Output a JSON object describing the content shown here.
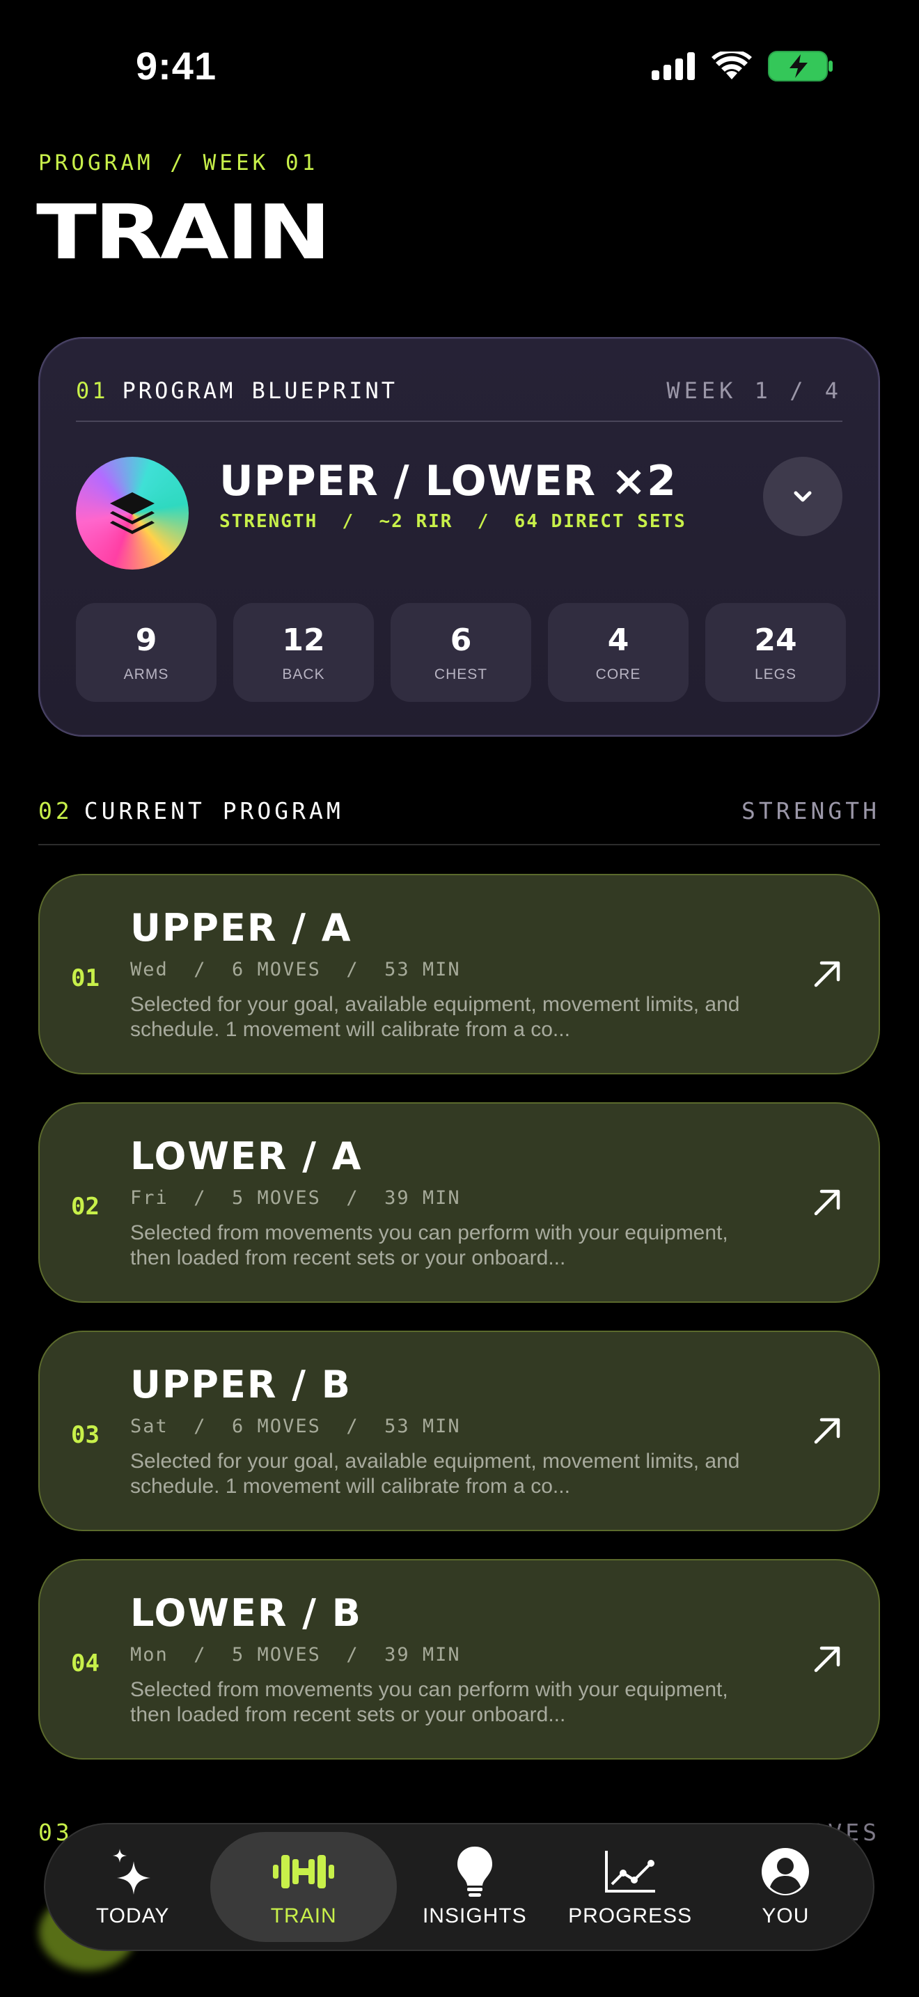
{
  "status_bar": {
    "time": "9:41"
  },
  "header": {
    "breadcrumb": "PROGRAM / WEEK 01",
    "title": "TRAIN"
  },
  "blueprint": {
    "section_num": "01",
    "section_label": "PROGRAM BLUEPRINT",
    "week": "WEEK 1 / 4",
    "icon": "stack-layers-icon",
    "title": "UPPER / LOWER ×2",
    "meta": "STRENGTH  /  ~2 RIR  /  64 DIRECT SETS",
    "stats": [
      {
        "value": "9",
        "label": "ARMS"
      },
      {
        "value": "12",
        "label": "BACK"
      },
      {
        "value": "6",
        "label": "CHEST"
      },
      {
        "value": "4",
        "label": "CORE"
      },
      {
        "value": "24",
        "label": "LEGS"
      }
    ]
  },
  "current_program": {
    "section_num": "02",
    "section_label": "CURRENT PROGRAM",
    "tag": "STRENGTH",
    "workouts": [
      {
        "num": "01",
        "title": "UPPER / A",
        "meta": "Wed  /  6 MOVES  /  53 MIN",
        "desc": "Selected for your goal, available equipment, movement limits, and schedule. 1 movement will calibrate from a co..."
      },
      {
        "num": "02",
        "title": "LOWER / A",
        "meta": "Fri  /  5 MOVES  /  39 MIN",
        "desc": "Selected from movements you can perform with your equipment, then loaded from recent sets or your onboard..."
      },
      {
        "num": "03",
        "title": "UPPER / B",
        "meta": "Sat  /  6 MOVES  /  53 MIN",
        "desc": "Selected for your goal, available equipment, movement limits, and schedule. 1 movement will calibrate from a co..."
      },
      {
        "num": "04",
        "title": "LOWER / B",
        "meta": "Mon  /  5 MOVES  /  39 MIN",
        "desc": "Selected from movements you can perform with your equipment, then loaded from recent sets or your onboard..."
      }
    ]
  },
  "next_section": {
    "section_num": "03",
    "tag": "OVES"
  },
  "tabbar": {
    "items": [
      {
        "label": "TODAY",
        "icon": "sparkles-icon"
      },
      {
        "label": "TRAIN",
        "icon": "dumbbell-icon",
        "active": true
      },
      {
        "label": "INSIGHTS",
        "icon": "lightbulb-icon"
      },
      {
        "label": "PROGRESS",
        "icon": "chart-line-icon"
      },
      {
        "label": "YOU",
        "icon": "person-icon"
      }
    ]
  },
  "colors": {
    "accent": "#c8f04a",
    "card_green": "#333a23",
    "card_purple": "#262236"
  }
}
